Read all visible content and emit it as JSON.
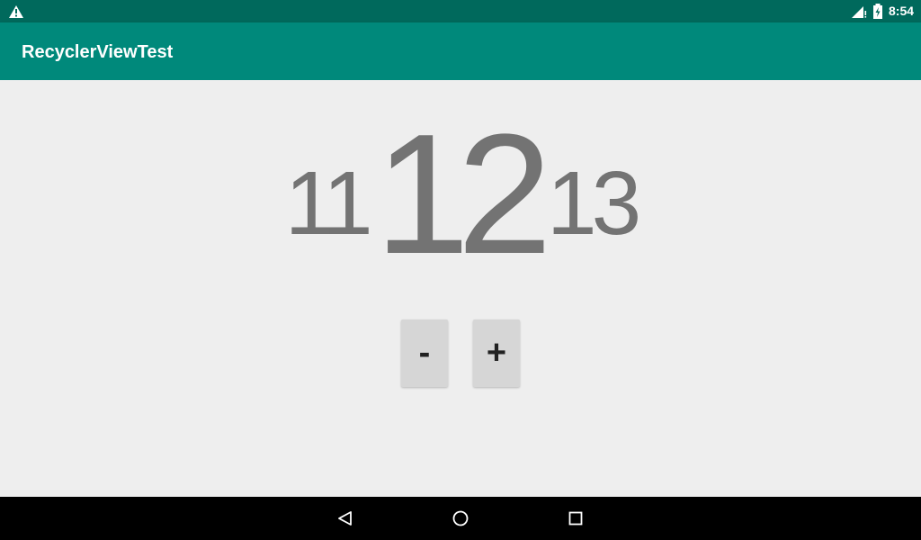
{
  "status_bar": {
    "time": "8:54",
    "left_icon": "warning-icon",
    "right_icons": [
      "cell-signal-icon",
      "battery-charging-icon"
    ]
  },
  "app_bar": {
    "title": "RecyclerViewTest"
  },
  "picker": {
    "previous": "11",
    "current": "12",
    "next": "13"
  },
  "buttons": {
    "decrement_label": "-",
    "increment_label": "+"
  },
  "nav_bar": {
    "icons": [
      "back-icon",
      "home-icon",
      "recents-icon"
    ]
  },
  "colors": {
    "status_bar": "#00695c",
    "app_bar": "#00897b",
    "background": "#eeeeee",
    "number_text": "#737373",
    "button": "#d6d6d6"
  }
}
